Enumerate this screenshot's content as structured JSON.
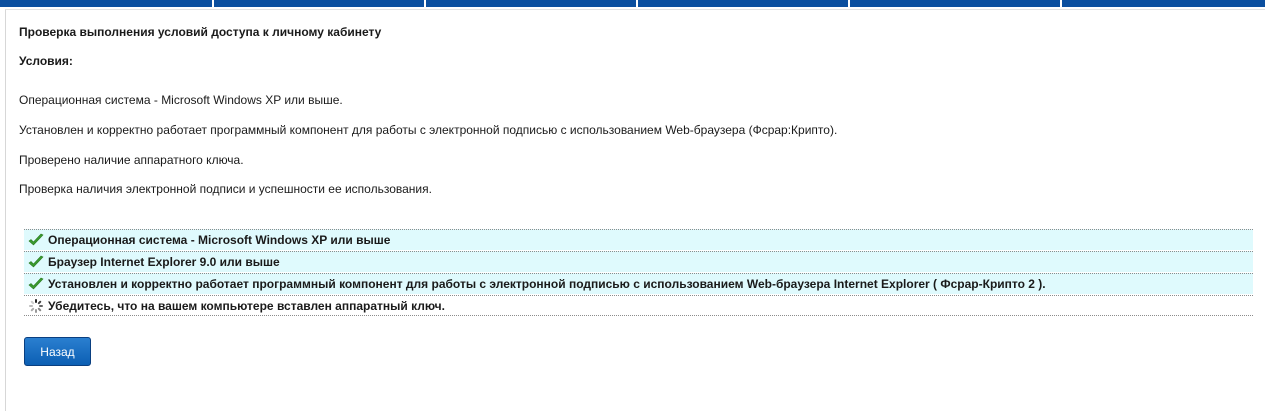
{
  "page_title": "Проверка выполнения условий доступа к личному кабинету",
  "conditions": {
    "heading": "Условия:",
    "lines": [
      "Операционная система - Microsoft Windows XP или выше.",
      "Установлен и корректно работает программный компонент для работы с электронной подписью с использованием Web-браузера (Фсрар:Крипто).",
      "Проверено наличие аппаратного ключа.",
      "Проверка наличия электронной подписи и успешности ее использования."
    ]
  },
  "checks": [
    {
      "icon": "checkmark-icon",
      "status": "ok",
      "text": "Операционная система - Microsoft Windows XP или выше"
    },
    {
      "icon": "checkmark-icon",
      "status": "ok",
      "text": "Браузер Internet Explorer 9.0 или выше"
    },
    {
      "icon": "checkmark-icon",
      "status": "ok",
      "text": "Установлен и корректно работает программный компонент для работы с электронной подписью с использованием Web-браузера Internet Explorer ( Фсрар-Крипто 2 )."
    },
    {
      "icon": "loading-spinner-icon",
      "status": "pending",
      "text": "Убедитесь, что на вашем компьютере вставлен аппаратный ключ."
    }
  ],
  "back_button": {
    "label": "Назад"
  },
  "colors": {
    "top_bar": "#0b4f9f",
    "ok_row_background": "#dffafd",
    "check_green": "#3a9b2e",
    "button_blue": "#0c5fb3"
  }
}
